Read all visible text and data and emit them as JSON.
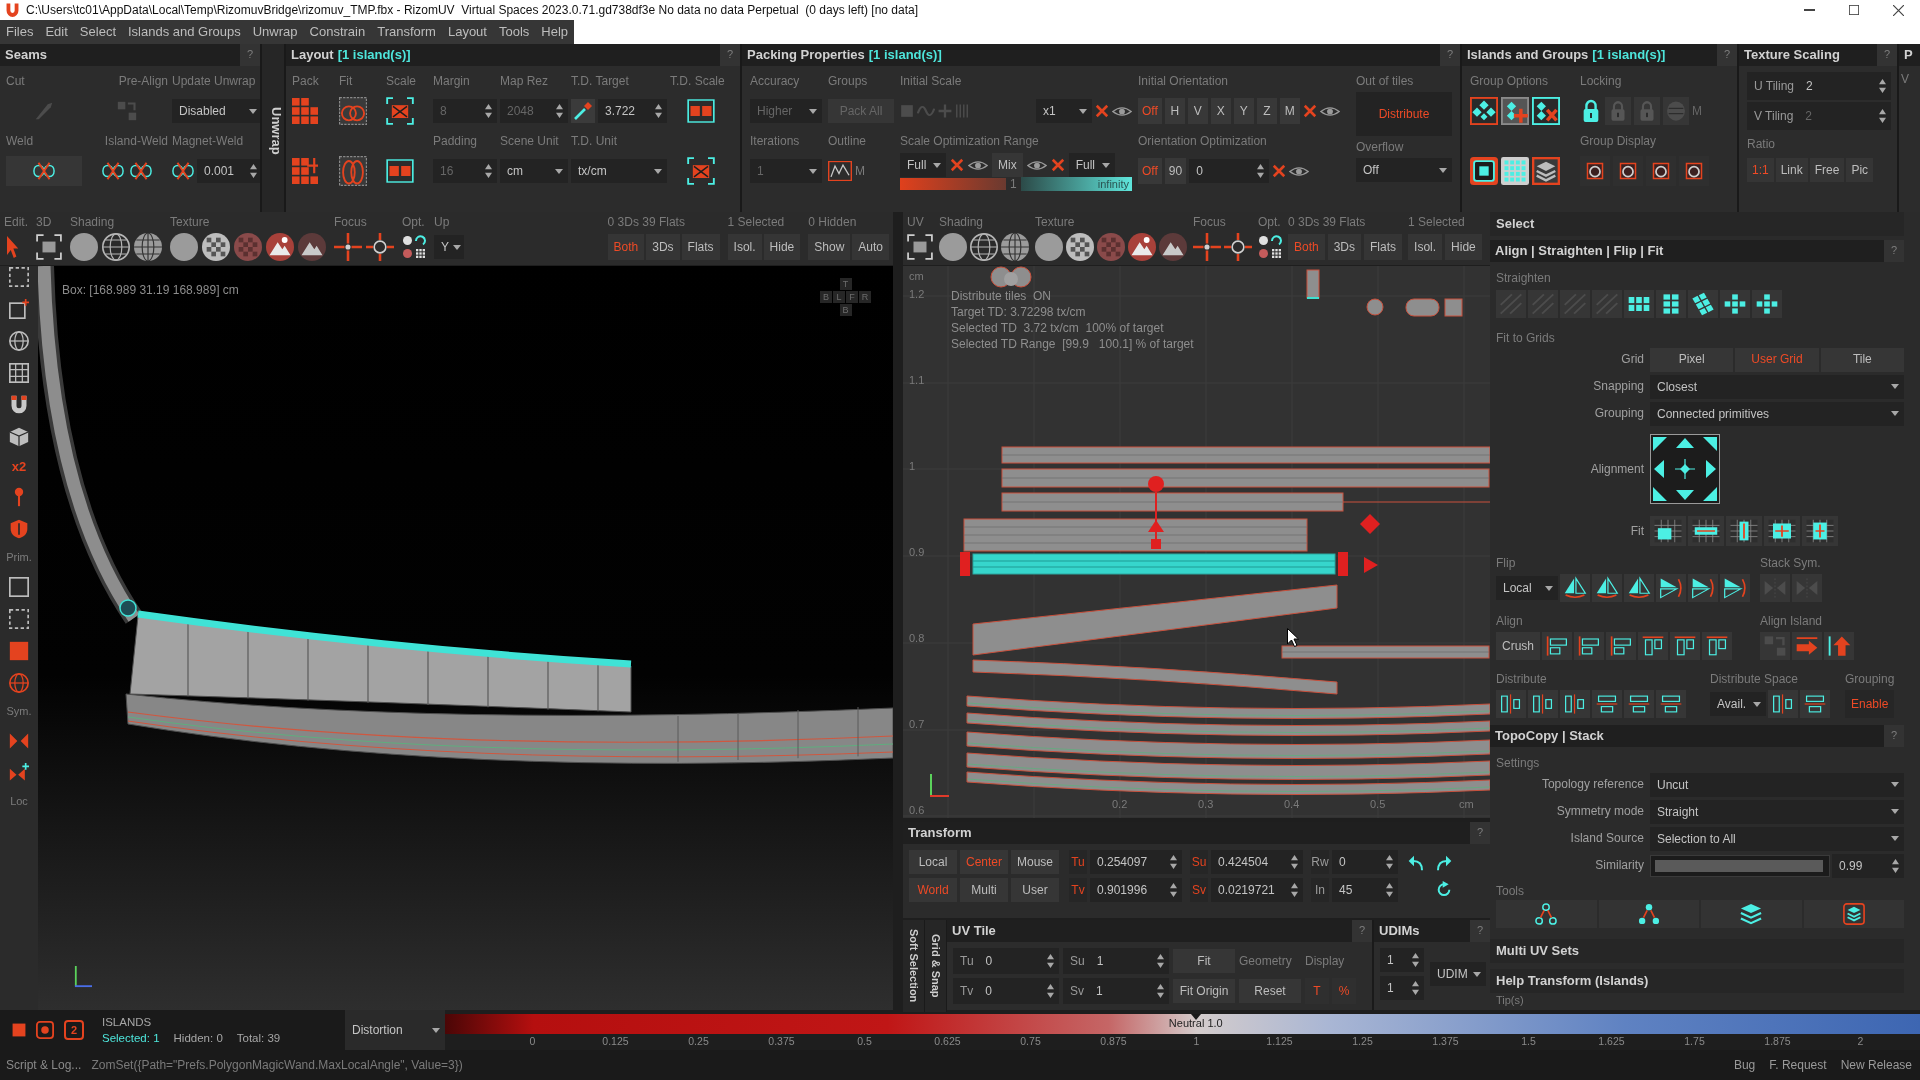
{
  "window": {
    "title": "C:\\Users\\tc01\\AppData\\Local\\Temp\\RizomuvBridge\\rizomuv_TMP.fbx - RizomUV  Virtual Spaces 2023.0.71.gd738df3e No data no data Perpetual  (0 days left) [no data]"
  },
  "menu": [
    "Files",
    "Edit",
    "Select",
    "Islands and Groups",
    "Unwrap",
    "Constrain",
    "Transform",
    "Layout",
    "Tools",
    "Help"
  ],
  "seams": {
    "title": "Seams",
    "help": "?",
    "cut": "Cut",
    "pre_align": "Pre-Align",
    "update_unwrap": "Update Unwrap",
    "update_value": "Disabled",
    "weld": "Weld",
    "island_weld": "Island-Weld",
    "magnet_weld": "Magnet-Weld",
    "magnet_value": "0.001"
  },
  "unwrap_tab": "Unwrap",
  "layout": {
    "title": "Layout",
    "count": "[1 island(s)]",
    "help": "?",
    "pack": "Pack",
    "fit": "Fit",
    "scale": "Scale",
    "margin": {
      "label": "Margin",
      "value": "8",
      "disabled": true
    },
    "map_rez": {
      "label": "Map Rez",
      "value": "2048",
      "disabled": true
    },
    "td_target": {
      "label": "T.D. Target",
      "value": "3.722"
    },
    "td_scale": "T.D. Scale",
    "padding": {
      "label": "Padding",
      "value": "16",
      "disabled": true
    },
    "scene_unit": {
      "label": "Scene Unit",
      "value": "cm"
    },
    "td_unit": {
      "label": "T.D. Unit",
      "value": "tx/cm"
    }
  },
  "packing": {
    "title": "Packing Properties",
    "count": "[1 island(s)]",
    "help": "?",
    "accuracy": {
      "label": "Accuracy",
      "value": "Higher",
      "disabled": true
    },
    "groups": {
      "label": "Groups",
      "value": "Pack All",
      "disabled": true
    },
    "iterations": {
      "label": "Iterations",
      "value": "1",
      "disabled": true
    },
    "outline": {
      "label": "Outline",
      "suffix": "M"
    },
    "initial_scale": {
      "label": "Initial Scale",
      "value": "x1"
    },
    "scale_range": {
      "label": "Scale Optimization Range",
      "from": "Full",
      "mix": "Mix",
      "to": "Full",
      "low": "1",
      "high": "infinity"
    },
    "initial_orientation": {
      "label": "Initial Orientation",
      "options": [
        {
          "label": "Off",
          "selected": true
        },
        {
          "label": "H",
          "selected": false
        },
        {
          "label": "V",
          "selected": false
        },
        {
          "label": "X",
          "selected": false
        },
        {
          "label": "Y",
          "selected": false
        },
        {
          "label": "Z",
          "selected": false
        },
        {
          "label": "M",
          "selected": false
        }
      ]
    },
    "orientation_optimization": {
      "label": "Orientation Optimization",
      "toggle": {
        "label": "Off",
        "on": true
      },
      "step": "90",
      "value": "0"
    },
    "out_of_tiles": {
      "label": "Out of tiles",
      "toggle": {
        "label": "Distribute",
        "on": true
      }
    },
    "overflow": {
      "label": "Overflow",
      "value": "Off"
    }
  },
  "islands_groups": {
    "title": "Islands and Groups",
    "count": "[1 island(s)]",
    "help": "?",
    "group_options": "Group Options",
    "locking": "Locking",
    "locking_mode": {
      "label": "M",
      "disabled": true
    },
    "group_display": "Group Display"
  },
  "texture_scaling": {
    "title": "Texture Scaling",
    "help": "?",
    "u_tiling": {
      "label": "U Tiling",
      "value": "2",
      "disabled": false
    },
    "v_tiling": {
      "label": "V Tiling",
      "value": "2",
      "disabled": true
    },
    "ratio": "Ratio",
    "ratio_options": [
      {
        "label": "1:1",
        "selected": true
      },
      {
        "label": "Link",
        "selected": false
      },
      {
        "label": "Free",
        "selected": false
      },
      {
        "label": "Pic",
        "selected": false
      }
    ]
  },
  "next_panel": {
    "title": "P",
    "label": "V"
  },
  "view_3d": {
    "toolbar": {
      "edit": "Edit.",
      "mode": "3D",
      "shading": "Shading",
      "texture": "Texture",
      "focus": "Focus",
      "options": "Opt.",
      "up": "Up",
      "up_value": "Y",
      "counts": "0 3Ds 39 Flats",
      "selected": "1 Selected",
      "hidden": "0 Hidden",
      "filter": [
        {
          "label": "Both",
          "selected": true
        },
        {
          "label": "3Ds",
          "selected": false
        },
        {
          "label": "Flats",
          "selected": false
        }
      ],
      "selection_actions": [
        "Isol.",
        "Hide"
      ],
      "hidden_actions": [
        "Show",
        "Auto"
      ]
    },
    "side_labels": {
      "multiplier": "x2",
      "primitives": "Prim.",
      "symmetry": "Sym.",
      "local": "Loc"
    },
    "box_info": "Box: [168.989 31.19 168.989] cm",
    "nav_cube": {
      "top": "T",
      "sides": [
        "B",
        "L",
        "F",
        "R"
      ],
      "bottom": "B"
    }
  },
  "uv_view": {
    "toolbar": {
      "mode": "UV",
      "shading": "Shading",
      "texture": "Texture",
      "focus": "Focus",
      "options": "Opt.",
      "counts": "0 3Ds 39 Flats",
      "selected": "1 Selected",
      "filter": [
        {
          "label": "Both",
          "selected": true
        },
        {
          "label": "3Ds",
          "selected": false
        },
        {
          "label": "Flats",
          "selected": false
        }
      ],
      "selection_actions": [
        "Isol.",
        "Hide"
      ]
    },
    "v_unit": "cm",
    "v_ticks": [
      "1.2",
      "1.1",
      "1",
      "0.9",
      "0.8",
      "0.7",
      "0.6"
    ],
    "u_ticks": [
      "0.2",
      "0.3",
      "0.4",
      "0.5"
    ],
    "u_unit": "cm",
    "info": [
      "Distribute tiles  ON",
      "Target TD: 3.72298 tx/cm",
      "Selected TD  3.72 tx/cm  100% of target",
      "Selected TD Range  [99.9   100.1] % of target"
    ]
  },
  "transform": {
    "title": "Transform",
    "help": "?",
    "modes": [
      {
        "label": "Local",
        "selected": false
      },
      {
        "label": "Center",
        "selected": true
      },
      {
        "label": "Mouse",
        "selected": false
      },
      {
        "label": "World",
        "selected": true
      },
      {
        "label": "Multi",
        "selected": false
      },
      {
        "label": "User",
        "selected": false
      }
    ],
    "fields": [
      {
        "label": "Tu",
        "value": "0.254097",
        "kind": "move"
      },
      {
        "label": "Su",
        "value": "0.424504",
        "kind": "scale"
      },
      {
        "label": "Rw",
        "value": "0",
        "kind": "rotate"
      },
      {
        "label": "Tv",
        "value": "0.901996",
        "kind": "move"
      },
      {
        "label": "Sv",
        "value": "0.0219721",
        "kind": "scale"
      },
      {
        "label": "In",
        "value": "45",
        "kind": "rotate"
      }
    ]
  },
  "side_tabs": [
    "Soft Selection",
    "Grid & Snap"
  ],
  "uv_tile": {
    "title": "UV Tile",
    "help": "?",
    "fields": [
      {
        "label": "Tu",
        "value": "0"
      },
      {
        "label": "Su",
        "value": "1"
      },
      {
        "label": "Tv",
        "value": "0"
      },
      {
        "label": "Sv",
        "value": "1"
      }
    ],
    "fit": "Fit",
    "fit_origin": "Fit Origin",
    "geometry": "Geometry",
    "reset": "Reset",
    "display": "Display",
    "display_options": [
      {
        "label": "T",
        "selected": true
      },
      {
        "label": "%",
        "selected": true
      }
    ]
  },
  "udims": {
    "title": "UDIMs",
    "help": "?",
    "values": [
      "1",
      "1"
    ],
    "mode": "UDIM"
  },
  "right_panel": {
    "select": "Select",
    "align": {
      "title": "Align | Straighten | Flip | Fit",
      "help": "?",
      "straighten": "Straighten",
      "fit_to_grids": "Fit to Grids",
      "grid": {
        "label": "Grid",
        "options": [
          {
            "label": "Pixel",
            "selected": false
          },
          {
            "label": "User Grid",
            "selected": true
          },
          {
            "label": "Tile",
            "selected": false
          }
        ]
      },
      "snapping": {
        "label": "Snapping",
        "value": "Closest"
      },
      "grouping": {
        "label": "Grouping",
        "value": "Connected primitives"
      },
      "alignment": "Alignment",
      "fit": "Fit",
      "flip": "Flip",
      "stack_sym": "Stack Sym.",
      "flip_space": "Local",
      "align": "Align",
      "align_island": "Align Island",
      "crush": "Crush",
      "distribute": "Distribute",
      "distribute_space": "Distribute Space",
      "distribute_grouping": "Grouping",
      "space_value": "Avail.",
      "grouping_toggle": {
        "label": "Enable",
        "on": true
      }
    },
    "topocopy": {
      "title": "TopoCopy | Stack",
      "help": "?",
      "settings": "Settings",
      "rows": [
        {
          "label": "Topology reference",
          "value": "Uncut"
        },
        {
          "label": "Symmetry mode",
          "value": "Straight"
        },
        {
          "label": "Island Source",
          "value": "Selection to All"
        }
      ],
      "similarity": {
        "label": "Similarity",
        "value": "0.99",
        "level": 0.99
      },
      "tools": "Tools"
    },
    "sections": [
      "Multi UV Sets",
      "Help Transform (Islands)"
    ],
    "tips": "Tip(s)"
  },
  "bottom_bar": {
    "badge": "2",
    "islands": "ISLANDS",
    "selected": "Selected: 1",
    "hidden": "Hidden: 0",
    "total": "Total: 39",
    "mode": "Distortion",
    "neutral": "Neutral 1.0",
    "ticks": [
      "0",
      "0.125",
      "0.25",
      "0.375",
      "0.5",
      "0.625",
      "0.75",
      "0.875",
      "1",
      "1.125",
      "1.25",
      "1.375",
      "1.5",
      "1.625",
      "1.75",
      "1.875",
      "2"
    ]
  },
  "status_bar": {
    "script": "Script & Log...",
    "command": "ZomSet({Path=\"Prefs.PolygonMagicWand.MaxLocalAngle\", Value=3})",
    "links": [
      "Bug",
      "F. Request",
      "New Release"
    ]
  }
}
